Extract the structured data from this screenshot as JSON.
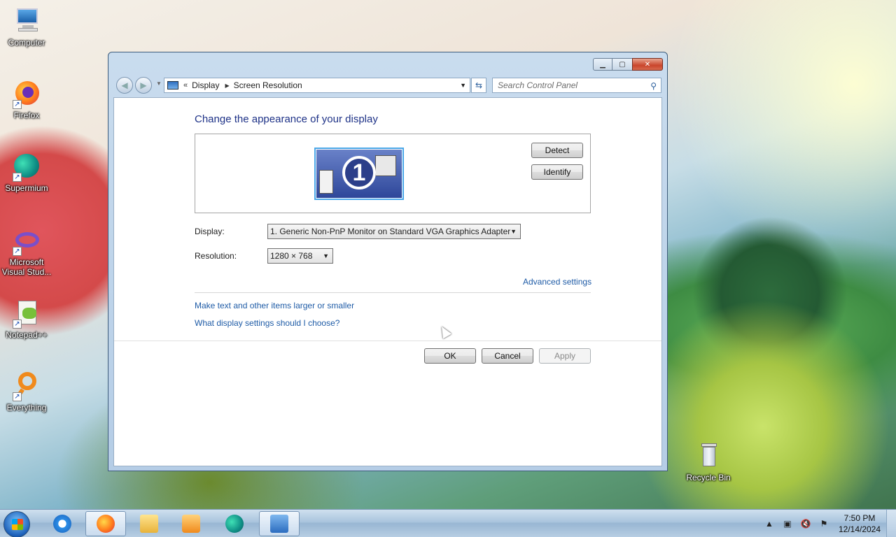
{
  "desktop": {
    "icons": [
      {
        "label": "Computer"
      },
      {
        "label": "Firefox"
      },
      {
        "label": "Supermium"
      },
      {
        "label": "Microsoft Visual Stud..."
      },
      {
        "label": "Notepad++"
      },
      {
        "label": "Everything"
      },
      {
        "label": "Recycle Bin"
      }
    ]
  },
  "window": {
    "breadcrumb": {
      "chevron": "«",
      "segments": [
        "Display",
        "Screen Resolution"
      ]
    },
    "search": {
      "placeholder": "Search Control Panel"
    },
    "title": "Change the appearance of your display",
    "monitor_number": "1",
    "detect_label": "Detect",
    "identify_label": "Identify",
    "display_label": "Display:",
    "display_value": "1. Generic Non-PnP Monitor on Standard VGA Graphics Adapter",
    "resolution_label": "Resolution:",
    "resolution_value": "1280 × 768",
    "advanced_link": "Advanced settings",
    "links": [
      "Make text and other items larger or smaller",
      "What display settings should I choose?"
    ],
    "ok_label": "OK",
    "cancel_label": "Cancel",
    "apply_label": "Apply"
  },
  "taskbar": {
    "clock_time": "7:50 PM",
    "clock_date": "12/14/2024"
  }
}
